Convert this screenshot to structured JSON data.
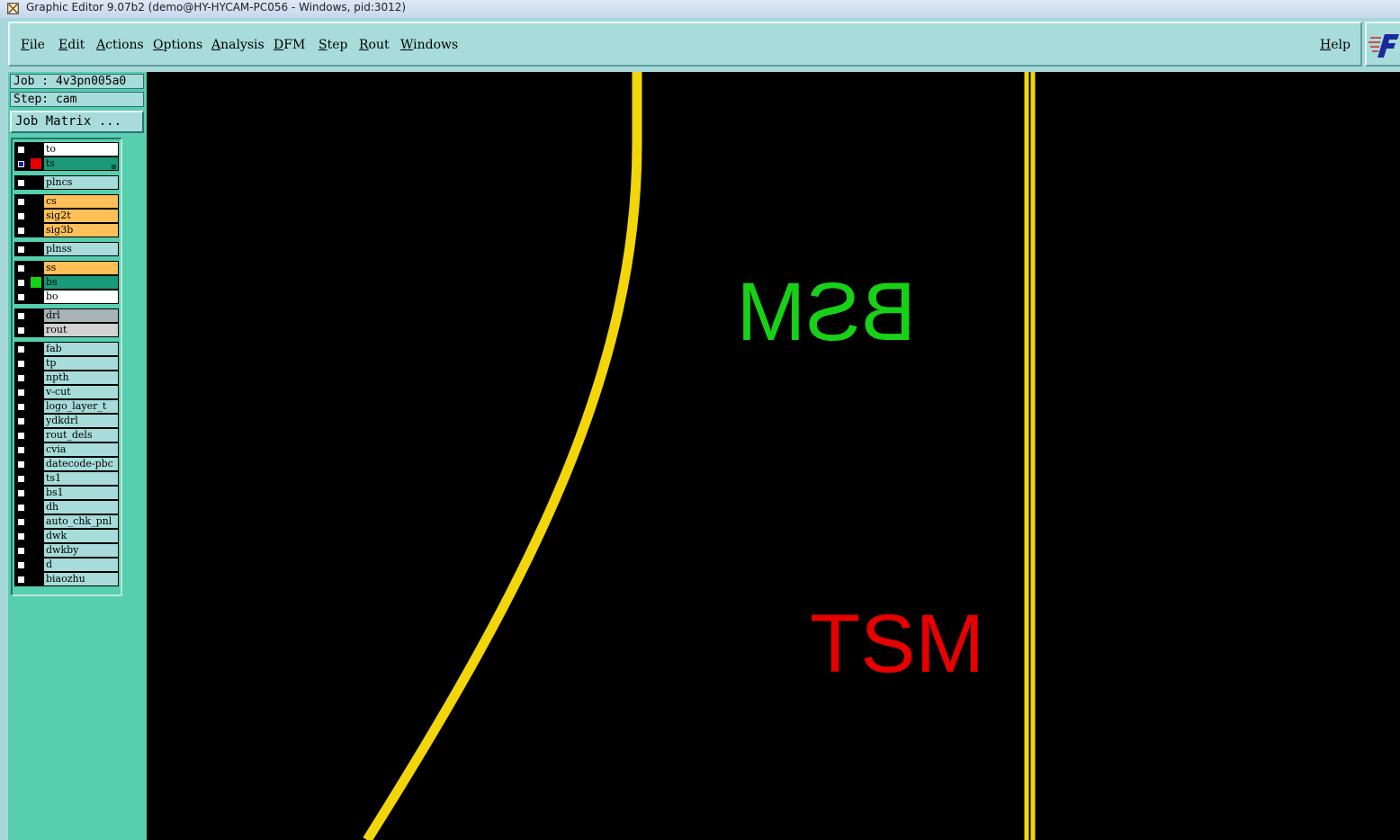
{
  "window": {
    "title": "Graphic Editor 9.07b2 (demo@HY-HYCAM-PC056 - Windows, pid:3012)"
  },
  "menu": {
    "items": [
      {
        "label": "File",
        "mnemonic": "F",
        "rest": "ile"
      },
      {
        "label": "Edit",
        "mnemonic": "E",
        "rest": "dit"
      },
      {
        "label": "Actions",
        "mnemonic": "A",
        "rest": "ctions"
      },
      {
        "label": "Options",
        "mnemonic": "O",
        "rest": "ptions"
      },
      {
        "label": "Analysis",
        "mnemonic": "A",
        "rest": "nalysis"
      },
      {
        "label": "DFM",
        "mnemonic": "D",
        "rest": "FM"
      },
      {
        "label": "Step",
        "mnemonic": "S",
        "rest": "tep"
      },
      {
        "label": "Rout",
        "mnemonic": "R",
        "rest": "out"
      },
      {
        "label": "Windows",
        "mnemonic": "W",
        "rest": "indows"
      }
    ],
    "help": {
      "label": "Help",
      "mnemonic": "H",
      "rest": "elp"
    }
  },
  "job_info": {
    "job": "Job : 4v3pn005a0",
    "step": "Step: cam",
    "matrix_button": "Job Matrix ..."
  },
  "layers": [
    {
      "name": "to",
      "bg": "#ffffff",
      "swatch": null,
      "checked": false
    },
    {
      "name": "ts",
      "bg": "#1a9a78",
      "swatch": "#e60000",
      "checked": true,
      "selected": true
    },
    {
      "name": "plncs",
      "bg": "#a7dcdb",
      "swatch": null,
      "checked": false
    },
    {
      "name": "cs",
      "bg": "#ffc05a",
      "swatch": null,
      "checked": false
    },
    {
      "name": "sig2t",
      "bg": "#ffc05a",
      "swatch": null,
      "checked": false
    },
    {
      "name": "sig3b",
      "bg": "#ffc05a",
      "swatch": null,
      "checked": false
    },
    {
      "name": "plnss",
      "bg": "#a7dcdb",
      "swatch": null,
      "checked": false
    },
    {
      "name": "ss",
      "bg": "#ffc05a",
      "swatch": null,
      "checked": false
    },
    {
      "name": "bs",
      "bg": "#1a9a78",
      "swatch": "#17d117",
      "checked": false
    },
    {
      "name": "bo",
      "bg": "#ffffff",
      "swatch": null,
      "checked": false
    },
    {
      "name": "drl",
      "bg": "#a9b4b6",
      "swatch": null,
      "checked": false
    },
    {
      "name": "rout",
      "bg": "#d2d2d2",
      "swatch": null,
      "checked": false
    },
    {
      "name": "fab",
      "bg": "#a7dcdb",
      "swatch": null,
      "checked": false
    },
    {
      "name": "tp",
      "bg": "#a7dcdb",
      "swatch": null,
      "checked": false
    },
    {
      "name": "npth",
      "bg": "#a7dcdb",
      "swatch": null,
      "checked": false
    },
    {
      "name": "v-cut",
      "bg": "#a7dcdb",
      "swatch": null,
      "checked": false
    },
    {
      "name": "logo_layer_t",
      "bg": "#a7dcdb",
      "swatch": null,
      "checked": false
    },
    {
      "name": "ydkdrl",
      "bg": "#a7dcdb",
      "swatch": null,
      "checked": false
    },
    {
      "name": "rout_dels",
      "bg": "#a7dcdb",
      "swatch": null,
      "checked": false
    },
    {
      "name": "cvia",
      "bg": "#a7dcdb",
      "swatch": null,
      "checked": false
    },
    {
      "name": "datecode-pbc",
      "bg": "#a7dcdb",
      "swatch": null,
      "checked": false
    },
    {
      "name": "ts1",
      "bg": "#a7dcdb",
      "swatch": null,
      "checked": false
    },
    {
      "name": "bs1",
      "bg": "#a7dcdb",
      "swatch": null,
      "checked": false
    },
    {
      "name": "dh",
      "bg": "#a7dcdb",
      "swatch": null,
      "checked": false
    },
    {
      "name": "auto_chk_pnl",
      "bg": "#a7dcdb",
      "swatch": null,
      "checked": false
    },
    {
      "name": "dwk",
      "bg": "#a7dcdb",
      "swatch": null,
      "checked": false
    },
    {
      "name": "dwkby",
      "bg": "#a7dcdb",
      "swatch": null,
      "checked": false
    },
    {
      "name": "d",
      "bg": "#a7dcdb",
      "swatch": null,
      "checked": false
    },
    {
      "name": "biaozhu",
      "bg": "#a7dcdb",
      "swatch": null,
      "checked": false
    }
  ],
  "canvas": {
    "background": "#000000",
    "outline_color": "#f2d60a",
    "text_bottom": {
      "text": "BSM",
      "color": "#17d117",
      "mirrored": true
    },
    "text_top": {
      "text": "TSM",
      "color": "#e60000",
      "mirrored": false
    }
  }
}
